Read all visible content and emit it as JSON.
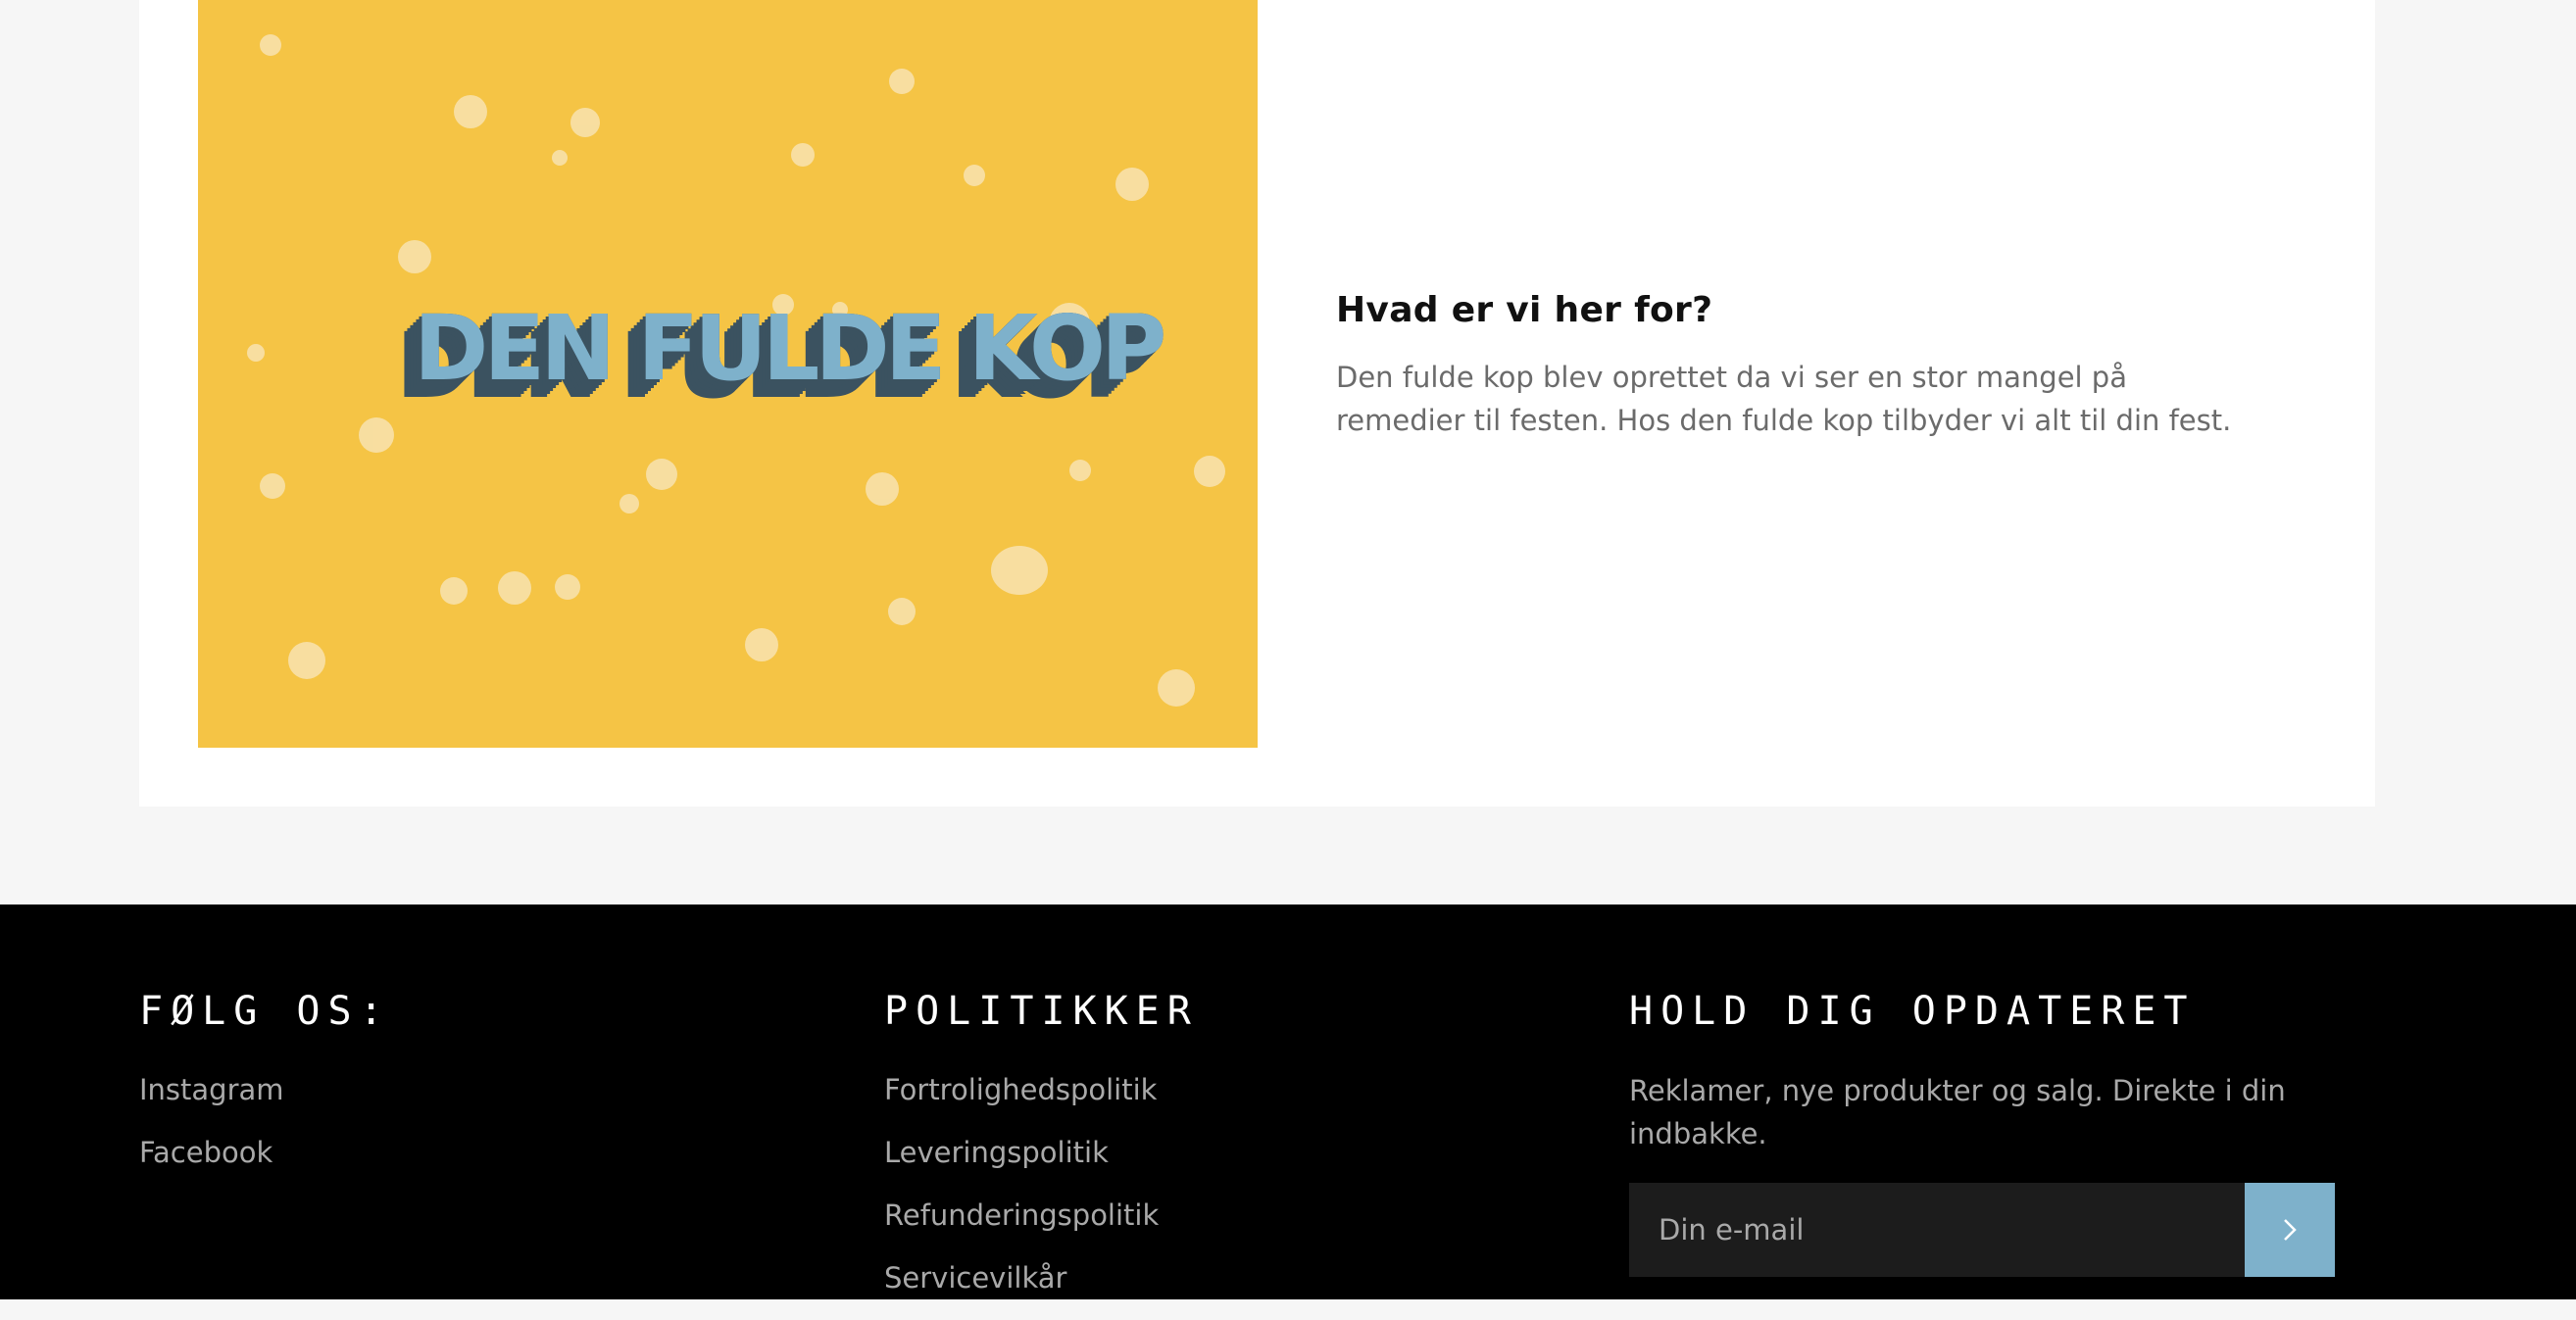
{
  "banner": {
    "logo_text": "DEN FULDE KOP",
    "background_color": "#f5c445",
    "logo_face_color": "#7eb1cb",
    "logo_shadow_color": "#3b5260"
  },
  "intro": {
    "heading": "Hvad er vi her for?",
    "body": "Den fulde kop blev oprettet da vi ser en stor mangel på remedier til festen. Hos den fulde kop tilbyder vi alt til din fest."
  },
  "footer": {
    "follow": {
      "title": "FØLG OS:",
      "links": [
        "Instagram",
        "Facebook"
      ]
    },
    "policies": {
      "title": "POLITIKKER",
      "links": [
        "Fortrolighedspolitik",
        "Leveringspolitik",
        "Refunderingspolitik",
        "Servicevilkår"
      ]
    },
    "newsletter": {
      "title": "HOLD DIG OPDATERET",
      "text": "Reklamer, nye produkter og salg. Direkte i din indbakke.",
      "email_placeholder": "Din e-mail",
      "submit_icon": "chevron-right-icon",
      "accent_color": "#7eb1cb"
    }
  }
}
